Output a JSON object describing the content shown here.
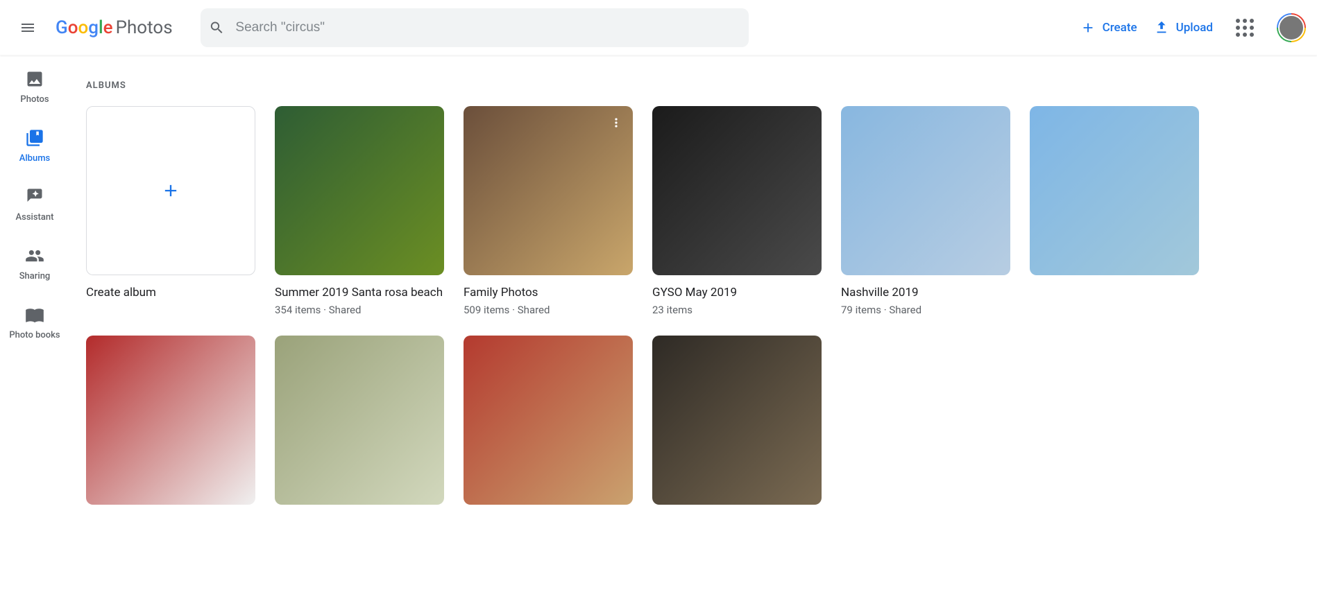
{
  "header": {
    "app_name": "Photos",
    "search_placeholder": "Search \"circus\"",
    "create_label": "Create",
    "upload_label": "Upload"
  },
  "sidebar": {
    "items": [
      {
        "label": "Photos"
      },
      {
        "label": "Albums"
      },
      {
        "label": "Assistant"
      },
      {
        "label": "Sharing"
      },
      {
        "label": "Photo books"
      }
    ],
    "active_index": 1
  },
  "section": {
    "label": "ALBUMS"
  },
  "create_album": {
    "label": "Create album"
  },
  "albums": [
    {
      "title": "Summer 2019 Santa rosa beach",
      "item_count": 354,
      "shared": true,
      "cover": "cov-a"
    },
    {
      "title": "Family Photos",
      "item_count": 509,
      "shared": true,
      "cover": "cov-b",
      "show_menu": true
    },
    {
      "title": "GYSO May 2019",
      "item_count": 23,
      "shared": false,
      "cover": "cov-c"
    },
    {
      "title": "Nashville 2019",
      "item_count": 79,
      "shared": true,
      "cover": "cov-d"
    },
    {
      "title": "",
      "item_count": null,
      "shared": false,
      "cover": "cov-e"
    },
    {
      "title": "",
      "item_count": null,
      "shared": false,
      "cover": "cov-f"
    },
    {
      "title": "",
      "item_count": null,
      "shared": false,
      "cover": "cov-g"
    },
    {
      "title": "",
      "item_count": null,
      "shared": false,
      "cover": "cov-h"
    },
    {
      "title": "",
      "item_count": null,
      "shared": false,
      "cover": "cov-i"
    }
  ],
  "strings": {
    "items_suffix": "items",
    "shared_label": "Shared"
  }
}
